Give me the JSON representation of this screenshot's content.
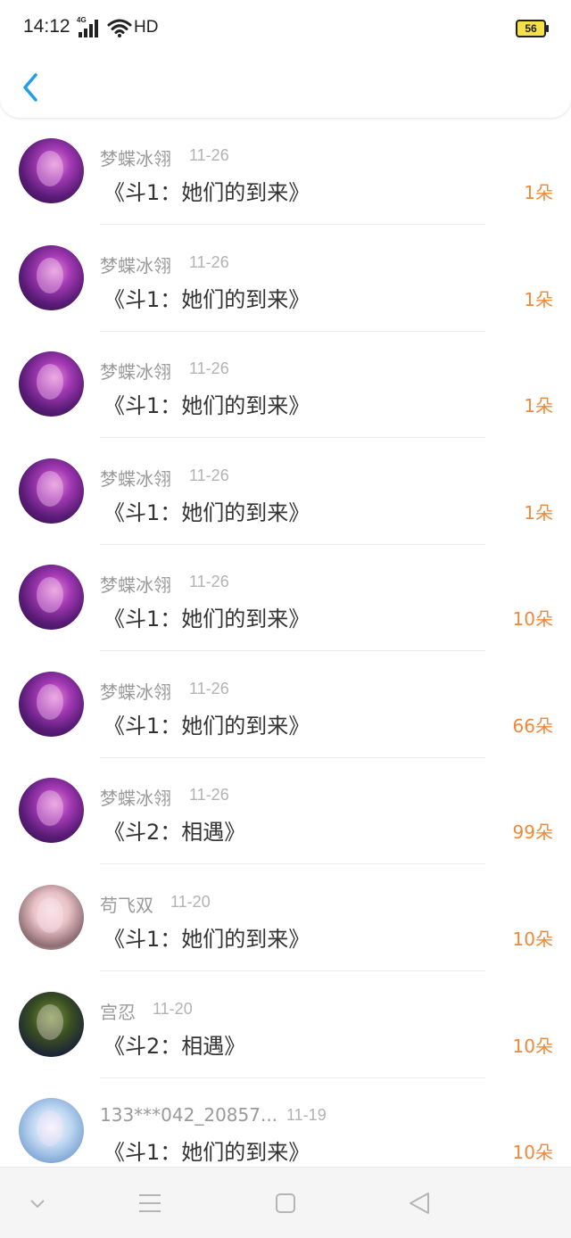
{
  "status_bar": {
    "time": "14:12",
    "network": "4G",
    "hd": "HD",
    "battery": "56"
  },
  "header": {
    "back_icon": "chevron-left-icon",
    "accent": "#1e9fe8"
  },
  "rows": [
    {
      "name": "梦蝶冰翎",
      "date": "11-26",
      "title": "《斗1：她们的到来》",
      "count": "1朵",
      "avatar": "purple"
    },
    {
      "name": "梦蝶冰翎",
      "date": "11-26",
      "title": "《斗1：她们的到来》",
      "count": "1朵",
      "avatar": "purple"
    },
    {
      "name": "梦蝶冰翎",
      "date": "11-26",
      "title": "《斗1：她们的到来》",
      "count": "1朵",
      "avatar": "purple"
    },
    {
      "name": "梦蝶冰翎",
      "date": "11-26",
      "title": "《斗1：她们的到来》",
      "count": "1朵",
      "avatar": "purple"
    },
    {
      "name": "梦蝶冰翎",
      "date": "11-26",
      "title": "《斗1：她们的到来》",
      "count": "10朵",
      "avatar": "purple"
    },
    {
      "name": "梦蝶冰翎",
      "date": "11-26",
      "title": "《斗1：她们的到来》",
      "count": "66朵",
      "avatar": "purple"
    },
    {
      "name": "梦蝶冰翎",
      "date": "11-26",
      "title": "《斗2：相遇》",
      "count": "99朵",
      "avatar": "purple"
    },
    {
      "name": "苟飞双",
      "date": "11-20",
      "title": "《斗1：她们的到来》",
      "count": "10朵",
      "avatar": "girl"
    },
    {
      "name": "宫忍",
      "date": "11-20",
      "title": "《斗2：相遇》",
      "count": "10朵",
      "avatar": "green"
    },
    {
      "name": "133***042_20857...",
      "date": "11-19",
      "title": "《斗1：她们的到来》",
      "count": "10朵",
      "avatar": "blue"
    }
  ],
  "colors": {
    "count": "#f0883a",
    "name": "#9a9a9a",
    "date": "#b3b3b3"
  },
  "nav_bar": {
    "icons": [
      "chevron-down-icon",
      "menu-icon",
      "home-square-icon",
      "back-triangle-icon"
    ]
  }
}
